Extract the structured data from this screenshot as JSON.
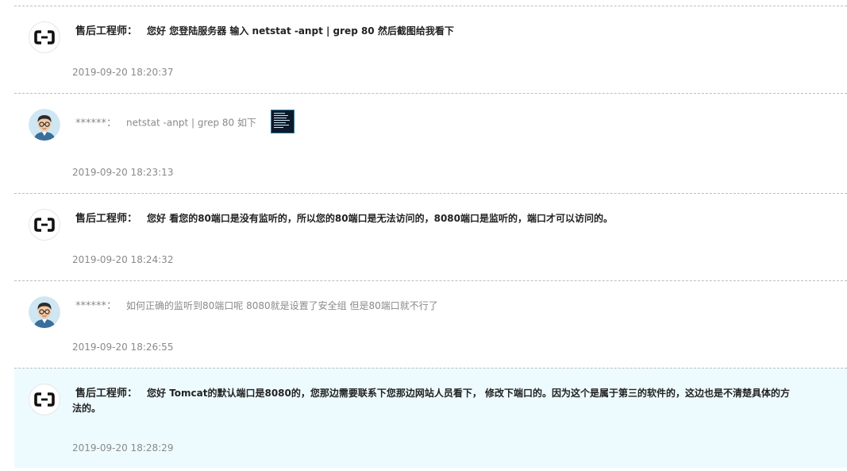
{
  "messages": [
    {
      "role": "staff",
      "avatar_icon": "aliyun-logo-icon",
      "sender": "售后工程师：",
      "text": "您好  您登陆服务器 输入 netstat  -anpt  |  grep   80  然后截图给我看下",
      "timestamp": "2019-09-20 18:20:37"
    },
    {
      "role": "user",
      "avatar_icon": "user-avatar-icon",
      "sender": "******：",
      "text": "netstat  -anpt  |  grep   80  如下",
      "attachment_icon": "screenshot-thumbnail-icon",
      "timestamp": "2019-09-20 18:23:13"
    },
    {
      "role": "staff",
      "avatar_icon": "aliyun-logo-icon",
      "sender": "售后工程师：",
      "text": "您好 看您的80端口是没有监听的，所以您的80端口是无法访问的，8080端口是监听的，端口才可以访问的。",
      "timestamp": "2019-09-20 18:24:32"
    },
    {
      "role": "user",
      "avatar_icon": "user-avatar-icon",
      "sender": "******：",
      "text": "如何正确的监听到80端口呢 8080就是设置了安全组 但是80端口就不行了",
      "timestamp": "2019-09-20 18:26:55"
    },
    {
      "role": "staff",
      "avatar_icon": "aliyun-logo-icon",
      "sender": "售后工程师：",
      "text": "您好  Tomcat的默认端口是8080的，您那边需要联系下您那边网站人员看下， 修改下端口的。因为这个是属于第三的软件的，这边也是不清楚具体的方法的。",
      "timestamp": "2019-09-20 18:28:29"
    }
  ],
  "colors": {
    "highlight_bg": "#eefbfe",
    "timestamp": "#8a8a8a",
    "staff_text": "#222222",
    "user_text": "#8a8a8a"
  }
}
